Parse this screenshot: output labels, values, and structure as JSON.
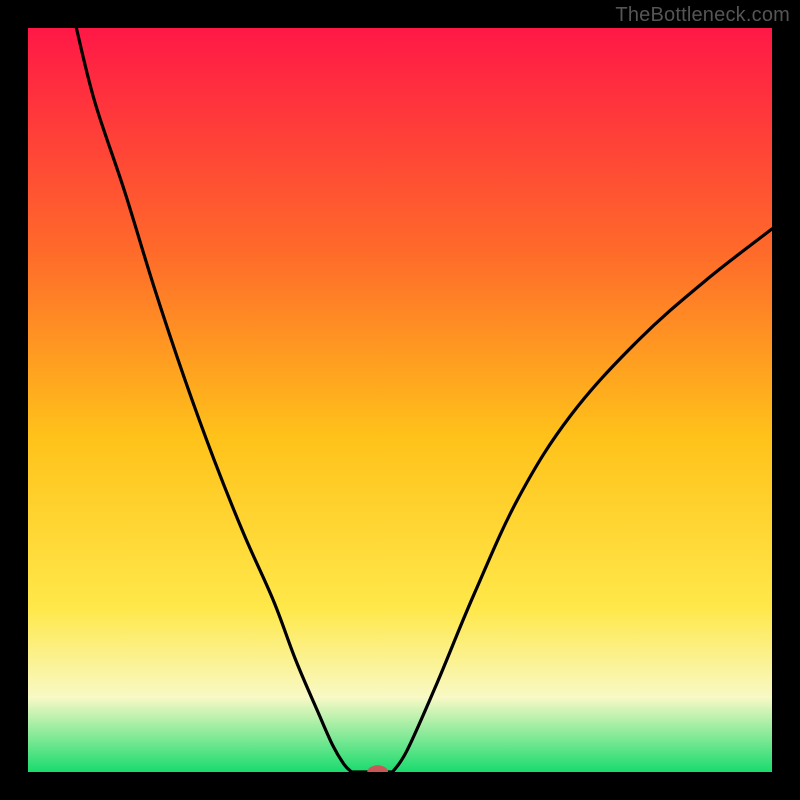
{
  "watermark": "TheBottleneck.com",
  "colors": {
    "bg_black": "#000000",
    "grad_top": "#ff1846",
    "grad_mid_upper": "#ff6a2a",
    "grad_mid": "#ffc21a",
    "grad_mid_lower": "#ffe84a",
    "grad_pale": "#f8f9c5",
    "grad_bottom": "#18db6e",
    "curve": "#000000",
    "marker": "#c9575a"
  },
  "chart_data": {
    "type": "line",
    "title": "",
    "xlabel": "",
    "ylabel": "",
    "xlim": [
      0,
      1
    ],
    "ylim": [
      0,
      1
    ],
    "series": [
      {
        "name": "left-branch",
        "x": [
          0.065,
          0.09,
          0.13,
          0.17,
          0.21,
          0.25,
          0.29,
          0.33,
          0.36,
          0.39,
          0.41,
          0.425,
          0.435
        ],
        "y": [
          1.0,
          0.9,
          0.78,
          0.65,
          0.53,
          0.42,
          0.32,
          0.23,
          0.15,
          0.08,
          0.035,
          0.01,
          0.0
        ]
      },
      {
        "name": "valley-floor",
        "x": [
          0.435,
          0.45,
          0.47,
          0.49
        ],
        "y": [
          0.0,
          0.0,
          0.0,
          0.0
        ]
      },
      {
        "name": "right-branch",
        "x": [
          0.49,
          0.51,
          0.55,
          0.6,
          0.66,
          0.73,
          0.82,
          0.91,
          1.0
        ],
        "y": [
          0.0,
          0.03,
          0.12,
          0.24,
          0.37,
          0.48,
          0.58,
          0.66,
          0.73
        ]
      }
    ],
    "marker": {
      "x": 0.47,
      "y": 0.0,
      "rx": 0.014,
      "ry": 0.009
    },
    "annotations": []
  }
}
